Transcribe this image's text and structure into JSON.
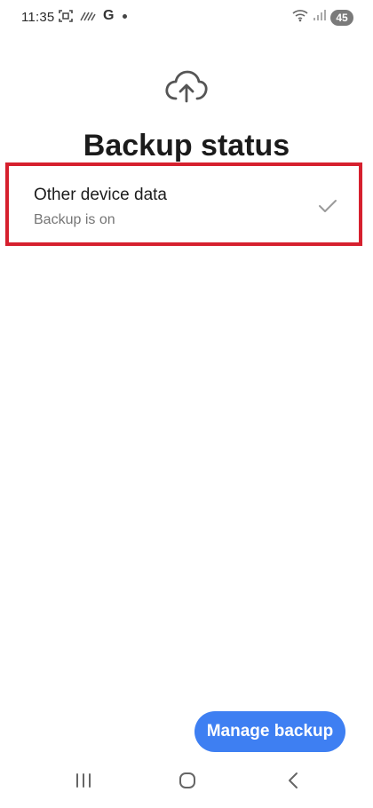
{
  "status_bar": {
    "time": "11:35",
    "left_icons": [
      "screenshot-icon",
      "signal-strength-icon",
      "google-icon",
      "notification-dot-icon"
    ],
    "google_letter": "G",
    "battery": "45",
    "right_icons": [
      "wifi-icon",
      "cellular-signal-icon",
      "battery-icon"
    ]
  },
  "header": {
    "icon": "cloud-upload-icon",
    "title": "Backup status"
  },
  "items": [
    {
      "title": "Other device data",
      "subtitle": "Backup is on",
      "icon": "checkmark-icon",
      "highlight_color": "#d6202e"
    }
  ],
  "actions": {
    "manage_label": "Manage backup",
    "accent_color": "#3e7ff2"
  },
  "navigation": {
    "icons": [
      "recent-apps-icon",
      "home-icon",
      "back-icon"
    ]
  }
}
